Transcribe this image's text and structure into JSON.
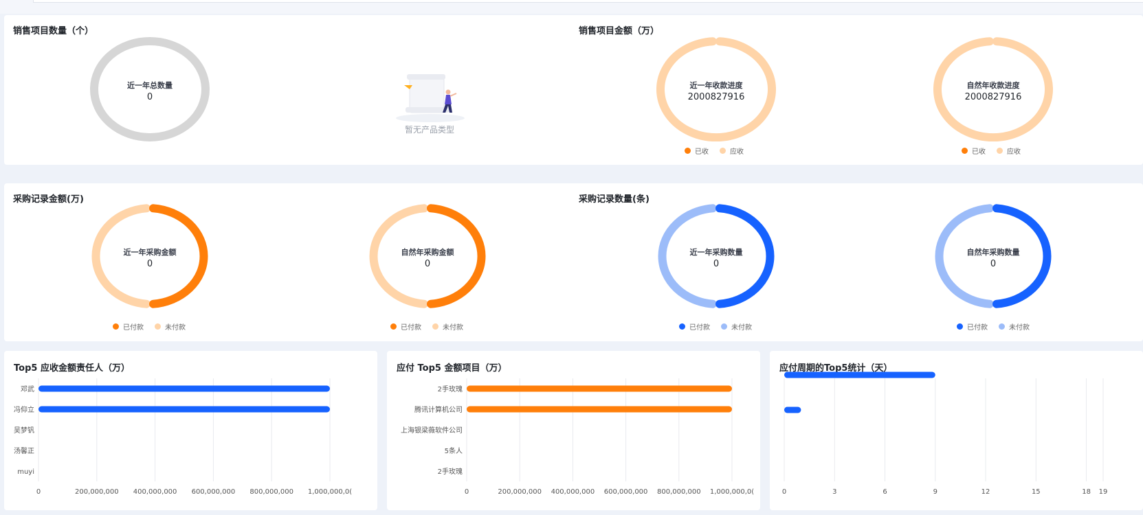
{
  "colors": {
    "orange": "#ff7f0a",
    "orange_light": "#ffd4a8",
    "blue": "#1662ff",
    "blue_light": "#9cbcf9",
    "gray": "#d6d6d6"
  },
  "sales_count": {
    "title": "销售项目数量（个）",
    "donut": {
      "label": "近一年总数量",
      "value": "0"
    },
    "empty_text": "暂无产品类型"
  },
  "sales_amount": {
    "title": "销售项目金额（万）",
    "donuts": [
      {
        "label": "近一年收款进度",
        "value": "2000827916",
        "received": 0,
        "receivable": 2000827916
      },
      {
        "label": "自然年收款进度",
        "value": "2000827916",
        "received": 0,
        "receivable": 2000827916
      }
    ],
    "legend": [
      "已收",
      "应收"
    ]
  },
  "purchase_amount": {
    "title": "采购记录金额(万)",
    "donuts": [
      {
        "label": "近一年采购金额",
        "value": "0"
      },
      {
        "label": "自然年采购金额",
        "value": "0"
      }
    ],
    "legend": [
      "已付款",
      "未付款"
    ]
  },
  "purchase_count": {
    "title": "采购记录数量(条)",
    "donuts": [
      {
        "label": "近一年采购数量",
        "value": "0"
      },
      {
        "label": "自然年采购数量",
        "value": "0"
      }
    ],
    "legend": [
      "已付款",
      "未付款"
    ]
  },
  "chart_data": [
    {
      "type": "bar",
      "orientation": "horizontal",
      "title": "Top5 应收金额责任人（万）",
      "categories": [
        "邓武",
        "冯仰立",
        "吴梦钒",
        "汤馨正",
        "muyi"
      ],
      "values": [
        1000000000,
        1000000000,
        0,
        0,
        0
      ],
      "xlim": [
        0,
        1000000000
      ],
      "xticks": [
        "0",
        "200,000,000",
        "400,000,000",
        "600,000,000",
        "800,000,000",
        "1,000,000,0("
      ],
      "grid": true
    },
    {
      "type": "bar",
      "orientation": "horizontal",
      "title": "应付 Top5 金额项目（万）",
      "categories": [
        "2手玫瑰",
        "腾讯计算机公司",
        "上海银梁薇软件公司",
        "5条人",
        "2手玫瑰"
      ],
      "values": [
        1000000000,
        1000000000,
        0,
        0,
        0
      ],
      "xlim": [
        0,
        1000000000
      ],
      "xticks": [
        "0",
        "200,000,000",
        "400,000,000",
        "600,000,000",
        "800,000,000",
        "1,000,000,0("
      ],
      "grid": true
    },
    {
      "type": "bar",
      "orientation": "horizontal",
      "title": "应付周期的Top5统计（天）",
      "categories": [
        "",
        "",
        "",
        "",
        ""
      ],
      "values": [
        9,
        0,
        1,
        0,
        0
      ],
      "xlim": [
        0,
        19
      ],
      "xticks": [
        "0",
        "3",
        "6",
        "9",
        "12",
        "15",
        "18",
        "19"
      ],
      "xtick_values": [
        0,
        3,
        6,
        9,
        12,
        15,
        18,
        19
      ],
      "grid": true
    }
  ]
}
